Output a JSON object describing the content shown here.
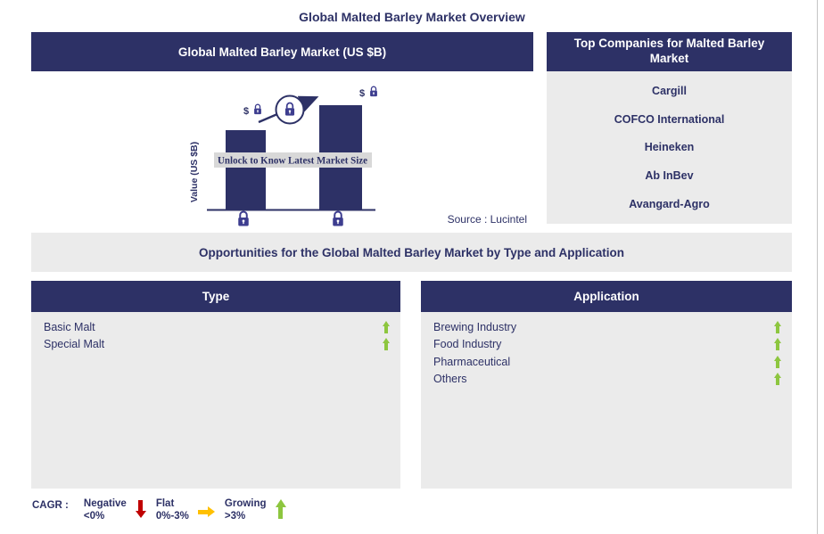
{
  "colors": {
    "navy": "#2d3166",
    "panel-gray": "#ebebeb",
    "banner-gray": "#d8d8d8",
    "green": "#8dc63f",
    "red": "#c00000",
    "orange": "#ffc000",
    "lock-purple": "#3d3d8f",
    "edge-gray": "#c4c4c4"
  },
  "page": {
    "title": "Global Malted Barley Market Overview"
  },
  "market_chart": {
    "header": "Global Malted Barley Market (US $B)",
    "y_axis_label": "Value (US $B)",
    "bar_value_prefix": "$",
    "overlay_banner": "Unlock to Know Latest Market Size",
    "source": "Source : Lucintel"
  },
  "chart_data": {
    "type": "bar",
    "title": "Global Malted Barley Market (US $B)",
    "ylabel": "Value (US $B)",
    "categories": [
      "base year (lock icon)",
      "forecast year (lock icon)"
    ],
    "values_hidden": true,
    "relative_bar_heights": [
      0.76,
      1.0
    ],
    "trend": "increasing",
    "annotations": [
      "$ with lock icon above each bar",
      "upward trend arrow passing through circled lock",
      "Unlock to Know Latest Market Size"
    ],
    "source": "Source : Lucintel"
  },
  "top_companies": {
    "header": "Top Companies for Malted Barley Market",
    "items": [
      "Cargill",
      "COFCO International",
      "Heineken",
      "Ab InBev",
      "Avangard-Agro"
    ]
  },
  "opportunities": {
    "band_title": "Opportunities for the Global Malted Barley Market by Type and Application",
    "type_panel": {
      "header": "Type",
      "items": [
        {
          "label": "Basic Malt",
          "trend": "growing"
        },
        {
          "label": "Special Malt",
          "trend": "growing"
        }
      ]
    },
    "application_panel": {
      "header": "Application",
      "items": [
        {
          "label": "Brewing Industry",
          "trend": "growing"
        },
        {
          "label": "Food Industry",
          "trend": "growing"
        },
        {
          "label": "Pharmaceutical",
          "trend": "growing"
        },
        {
          "label": "Others",
          "trend": "growing"
        }
      ]
    }
  },
  "cagr_legend": {
    "label": "CAGR :",
    "items": [
      {
        "name": "Negative",
        "range": "<0%",
        "direction": "down"
      },
      {
        "name": "Flat",
        "range": "0%-3%",
        "direction": "right"
      },
      {
        "name": "Growing",
        "range": ">3%",
        "direction": "up"
      }
    ]
  }
}
